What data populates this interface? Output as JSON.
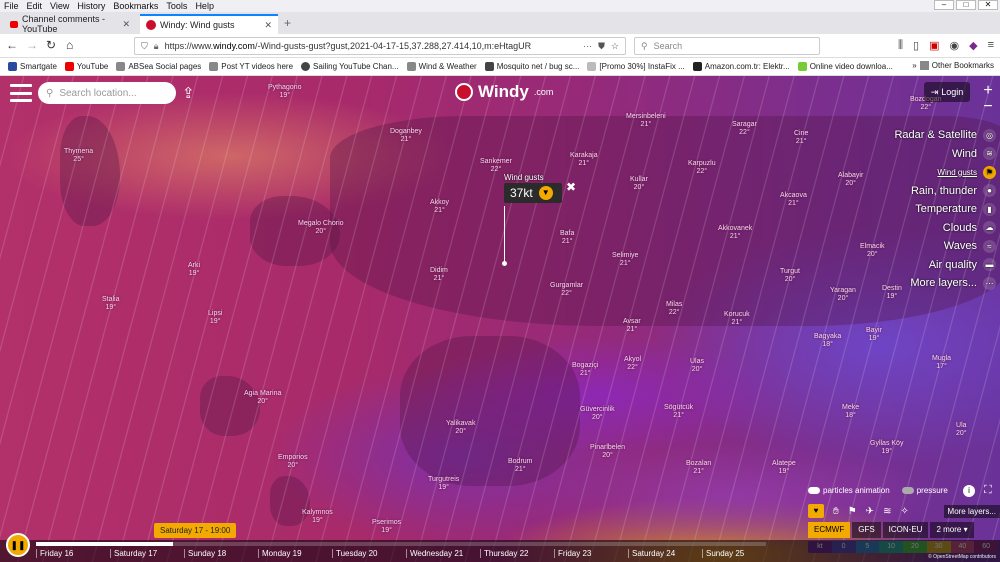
{
  "menubar": [
    "File",
    "Edit",
    "View",
    "History",
    "Bookmarks",
    "Tools",
    "Help"
  ],
  "tabs": [
    {
      "title": "Channel comments - YouTube"
    },
    {
      "title": "Windy: Wind gusts"
    }
  ],
  "navbar": {
    "url_prefix": "https://www.",
    "url_domain": "windy.com",
    "url_rest": "/-Wind-gusts-gust?gust,2021-04-17-15,37.288,27.414,10,m:eHtagUR",
    "search_placeholder": "Search"
  },
  "bookmarks": [
    "Smartgate",
    "YouTube",
    "ABSea Social pages",
    "Post YT videos here",
    "Sailing YouTube Chan...",
    "Wind & Weather",
    "Mosquito net / bug sc...",
    "[Promo 30%] InstaFix ...",
    "Amazon.com.tr: Elektr...",
    "Online video downloa..."
  ],
  "bookmarks_other": "Other Bookmarks",
  "windy": {
    "search_placeholder": "Search location...",
    "logo": "Windy",
    "logo_suffix": ".com",
    "login": "Login"
  },
  "layers": [
    {
      "label": "Radar & Satellite",
      "icon": "radar-icon"
    },
    {
      "label": "Wind",
      "icon": "wind-icon"
    },
    {
      "label": "Wind gusts",
      "icon": "gusts-icon",
      "sub": true,
      "active": true
    },
    {
      "label": "Rain, thunder",
      "icon": "rain-icon"
    },
    {
      "label": "Temperature",
      "icon": "temperature-icon"
    },
    {
      "label": "Clouds",
      "icon": "cloud-icon"
    },
    {
      "label": "Waves",
      "icon": "waves-icon"
    },
    {
      "label": "Air quality",
      "icon": "car-icon"
    },
    {
      "label": "More layers...",
      "icon": "more-icon"
    }
  ],
  "picker": {
    "label": "Wind gusts",
    "value": "37kt"
  },
  "cities": [
    {
      "name": "Pythagorio",
      "t": "19°"
    },
    {
      "name": "Thymena",
      "t": "25°"
    },
    {
      "name": "Doganbey",
      "t": "21°"
    },
    {
      "name": "Sankemer",
      "t": "22°"
    },
    {
      "name": "Akkoy",
      "t": "21°"
    },
    {
      "name": "Megalo Chorio",
      "t": "20°"
    },
    {
      "name": "Karakaja",
      "t": "21°"
    },
    {
      "name": "Bafa",
      "t": "21°"
    },
    {
      "name": "Kullar",
      "t": "20°"
    },
    {
      "name": "Didim",
      "t": "21°"
    },
    {
      "name": "Gurgamlar",
      "t": "22°"
    },
    {
      "name": "Selimiye",
      "t": "21°"
    },
    {
      "name": "Akkovanek",
      "t": "21°"
    },
    {
      "name": "Akcaova",
      "t": "21°"
    },
    {
      "name": "Arki",
      "t": "19°"
    },
    {
      "name": "Stalia",
      "t": "19°"
    },
    {
      "name": "Lipsi",
      "t": "19°"
    },
    {
      "name": "Milas",
      "t": "22°"
    },
    {
      "name": "Avsar",
      "t": "21°"
    },
    {
      "name": "Korucuk",
      "t": "21°"
    },
    {
      "name": "Turgut",
      "t": "20°"
    },
    {
      "name": "Yaragan",
      "t": "20°"
    },
    {
      "name": "Destin",
      "t": "19°"
    },
    {
      "name": "Agia Marina",
      "t": "20°"
    },
    {
      "name": "Bogaziçi",
      "t": "21°"
    },
    {
      "name": "Akyol",
      "t": "22°"
    },
    {
      "name": "Ulas",
      "t": "20°"
    },
    {
      "name": "Bagyaka",
      "t": "18°"
    },
    {
      "name": "Bayir",
      "t": "19°"
    },
    {
      "name": "Mugla",
      "t": "17°"
    },
    {
      "name": "Güvercinlik",
      "t": "20°"
    },
    {
      "name": "Sögütcük",
      "t": "21°"
    },
    {
      "name": "Meke",
      "t": "18°"
    },
    {
      "name": "Yalikavak",
      "t": "20°"
    },
    {
      "name": "Pinarlbelen",
      "t": "20°"
    },
    {
      "name": "Emporios",
      "t": "20°"
    },
    {
      "name": "Bodrum",
      "t": "21°"
    },
    {
      "name": "Bozalan",
      "t": "21°"
    },
    {
      "name": "Alatepe",
      "t": "19°"
    },
    {
      "name": "Gyllas Köy",
      "t": "19°"
    },
    {
      "name": "Turgutreis",
      "t": "19°"
    },
    {
      "name": "Kalymnos",
      "t": "19°"
    },
    {
      "name": "Pserimos",
      "t": "19°"
    },
    {
      "name": "Ula",
      "t": "20°"
    },
    {
      "name": "Saragar",
      "t": "22°"
    },
    {
      "name": "Mersinbeleni",
      "t": "21°"
    },
    {
      "name": "Karpuzlu",
      "t": "22°"
    },
    {
      "name": "Cine",
      "t": "21°"
    },
    {
      "name": "Alabayir",
      "t": "20°"
    },
    {
      "name": "Bozdogan",
      "t": "22°"
    },
    {
      "name": "Elmacik",
      "t": "20°"
    }
  ],
  "timeline": {
    "tooltip": "Saturday 17 - 19:00",
    "days": [
      "Friday 16",
      "Saturday 17",
      "Sunday 18",
      "Monday 19",
      "Tuesday 20",
      "Wednesday 21",
      "Thursday 22",
      "Friday 23",
      "Saturday 24",
      "Sunday 25"
    ],
    "progress": 0.187
  },
  "switches": {
    "particles": "particles animation",
    "pressure": "pressure"
  },
  "more_layers": "More layers...",
  "models": [
    {
      "label": "ECMWF",
      "selected": true
    },
    {
      "label": "GFS"
    },
    {
      "label": "ICON-EU"
    },
    {
      "label": "2 more ▾"
    }
  ],
  "scale": {
    "labels": [
      "kt",
      "0",
      "5",
      "10",
      "20",
      "30",
      "40",
      "60"
    ],
    "colors": [
      "#6a2c8f",
      "#5a4bb0",
      "#3a7cc0",
      "#2fa39a",
      "#4fb64a",
      "#c9a52a",
      "#c24d7a",
      "#8a2e78"
    ]
  },
  "attribution": "© OpenStreetMap contributors"
}
